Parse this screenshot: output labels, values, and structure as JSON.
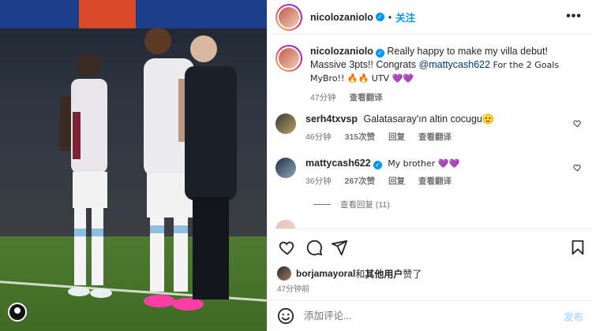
{
  "colors": {
    "accent": "#0095f6",
    "mention": "#00376b",
    "secondary_text": "#737373",
    "post_button_disabled": "#b3dbff"
  },
  "header": {
    "username": "nicolozaniolo",
    "separator": "•",
    "follow_label": "关注",
    "more_icon": "more-horizontal-icon"
  },
  "caption": {
    "username": "nicolozaniolo",
    "text_before": "Really happy to make my villa debut! Massive 3pts!! Congrats ",
    "mention": "@mattycash622",
    "text_after": " For the 2 Goals MyBro!! 🔥🔥 UTV 💜💜",
    "time": "47分钟",
    "translate": "查看翻译"
  },
  "comments": [
    {
      "username": "serh4txvsp",
      "text": "Galatasaray'ın altin cocugu🫡",
      "time": "46分钟",
      "likes": "315次赞",
      "reply": "回复",
      "translate": "查看翻译"
    },
    {
      "username": "mattycash622",
      "text": "My brother 💜💜",
      "time": "36分钟",
      "likes": "267次赞",
      "reply": "回复",
      "translate": "查看翻译"
    }
  ],
  "view_replies": "查看回复 (11)",
  "action_icons": [
    "heart-icon",
    "comment-icon",
    "share-icon",
    "bookmark-icon"
  ],
  "likes_line": {
    "user": "borjamayoral",
    "mid": "和",
    "others": "其他用户",
    "end": "赞了"
  },
  "post_time": "47分钟前",
  "comment_input": {
    "placeholder": "添加评论...",
    "post_label": "发布"
  }
}
